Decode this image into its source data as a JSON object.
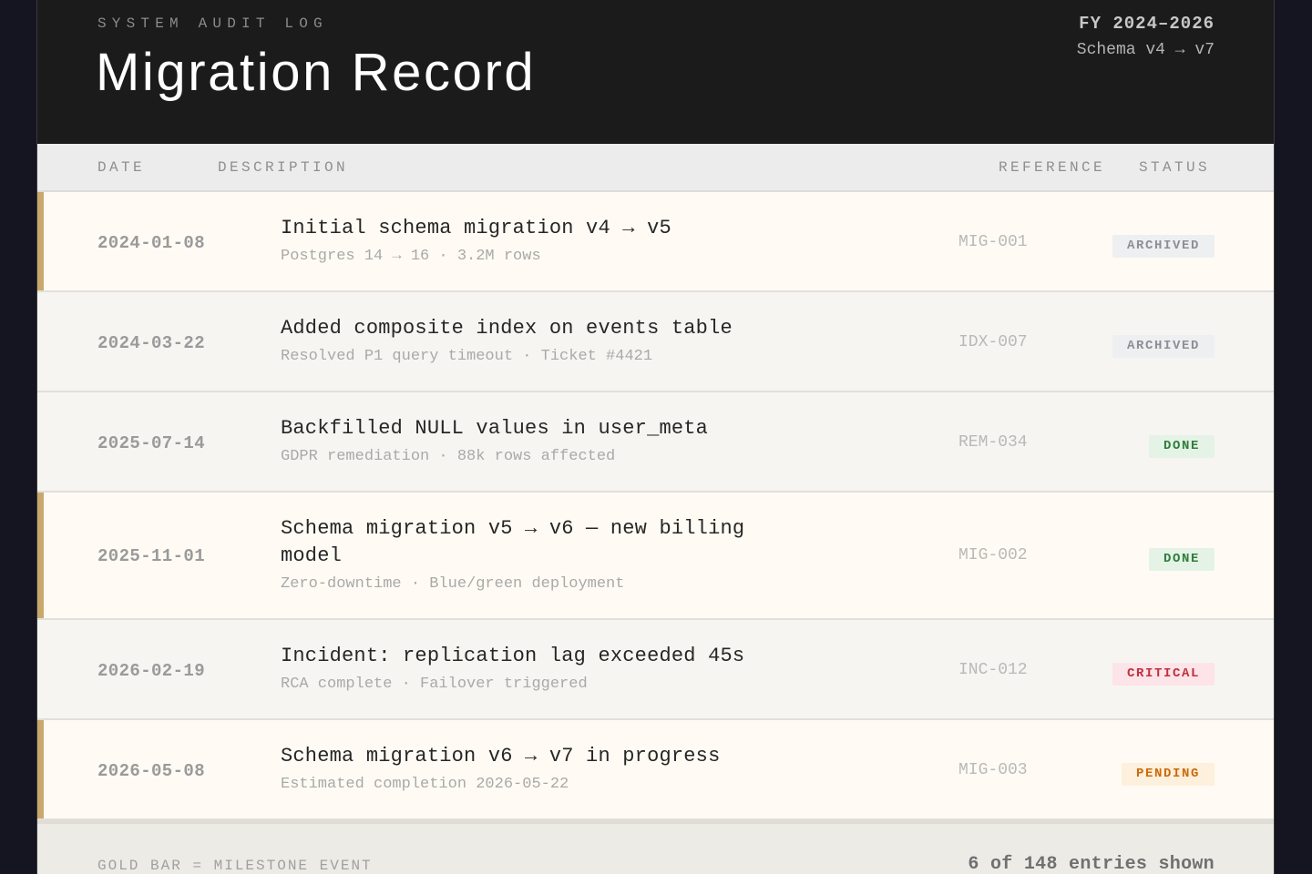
{
  "header": {
    "eyebrow": "SYSTEM AUDIT LOG",
    "title": "Migration Record",
    "fiscal_range": "FY 2024–2026",
    "schema_range": "Schema v4 → v7"
  },
  "columns": {
    "date": "DATE",
    "description": "DESCRIPTION",
    "reference": "REFERENCE",
    "status": "STATUS"
  },
  "rows": [
    {
      "milestone": true,
      "date": "2024-01-08",
      "title": "Initial schema migration v4 → v5",
      "subtitle": "Postgres 14 → 16 · 3.2M rows",
      "reference": "MIG-001",
      "status": "ARCHIVED",
      "status_kind": "archived"
    },
    {
      "milestone": false,
      "date": "2024-03-22",
      "title": "Added composite index on events table",
      "subtitle": "Resolved P1 query timeout · Ticket #4421",
      "reference": "IDX-007",
      "status": "ARCHIVED",
      "status_kind": "archived"
    },
    {
      "milestone": false,
      "date": "2025-07-14",
      "title": "Backfilled NULL values in user_meta",
      "subtitle": "GDPR remediation · 88k rows affected",
      "reference": "REM-034",
      "status": "DONE",
      "status_kind": "done"
    },
    {
      "milestone": true,
      "date": "2025-11-01",
      "title": "Schema migration v5 → v6 — new billing model",
      "subtitle": "Zero-downtime · Blue/green deployment",
      "reference": "MIG-002",
      "status": "DONE",
      "status_kind": "done"
    },
    {
      "milestone": false,
      "date": "2026-02-19",
      "title": "Incident: replication lag exceeded 45s",
      "subtitle": "RCA complete · Failover triggered",
      "reference": "INC-012",
      "status": "CRITICAL",
      "status_kind": "critical"
    },
    {
      "milestone": true,
      "date": "2026-05-08",
      "title": "Schema migration v6 → v7 in progress",
      "subtitle": "Estimated completion 2026-05-22",
      "reference": "MIG-003",
      "status": "PENDING",
      "status_kind": "pending"
    }
  ],
  "footer": {
    "legend": "GOLD BAR = MILESTONE EVENT",
    "count": "6 of 148 entries shown"
  },
  "colors": {
    "milestone_bar": "#c9a96b",
    "header_bg": "#1b1b1b",
    "archived": "#8b8f96",
    "done": "#2f7d3b",
    "critical": "#c0303e",
    "pending": "#cc6a0a"
  }
}
